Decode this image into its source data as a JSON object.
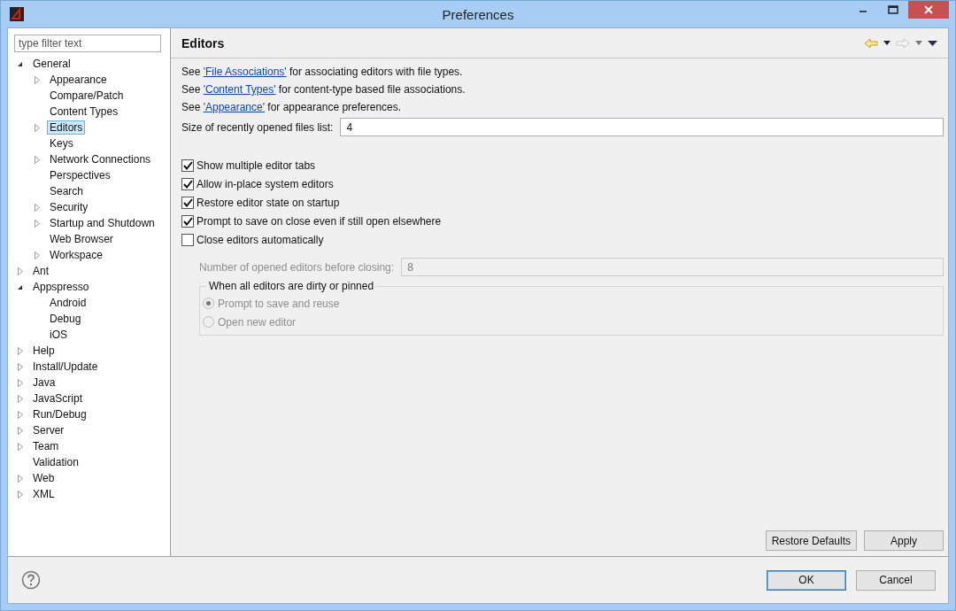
{
  "window": {
    "title": "Preferences"
  },
  "filter": {
    "placeholder": "type filter text"
  },
  "tree": [
    {
      "label": "General",
      "kind": "branch",
      "expanded": true,
      "selected": false,
      "children": [
        {
          "label": "Appearance",
          "kind": "branch",
          "expanded": false,
          "selected": false
        },
        {
          "label": "Compare/Patch",
          "kind": "leaf",
          "selected": false
        },
        {
          "label": "Content Types",
          "kind": "leaf",
          "selected": false
        },
        {
          "label": "Editors",
          "kind": "branch",
          "expanded": false,
          "selected": true
        },
        {
          "label": "Keys",
          "kind": "leaf",
          "selected": false
        },
        {
          "label": "Network Connections",
          "kind": "branch",
          "expanded": false,
          "selected": false
        },
        {
          "label": "Perspectives",
          "kind": "leaf",
          "selected": false
        },
        {
          "label": "Search",
          "kind": "leaf",
          "selected": false
        },
        {
          "label": "Security",
          "kind": "branch",
          "expanded": false,
          "selected": false
        },
        {
          "label": "Startup and Shutdown",
          "kind": "branch",
          "expanded": false,
          "selected": false
        },
        {
          "label": "Web Browser",
          "kind": "leaf",
          "selected": false
        },
        {
          "label": "Workspace",
          "kind": "branch",
          "expanded": false,
          "selected": false
        }
      ]
    },
    {
      "label": "Ant",
      "kind": "branch",
      "expanded": false,
      "selected": false
    },
    {
      "label": "Appspresso",
      "kind": "branch",
      "expanded": true,
      "selected": false,
      "children": [
        {
          "label": "Android",
          "kind": "leaf",
          "selected": false
        },
        {
          "label": "Debug",
          "kind": "leaf",
          "selected": false
        },
        {
          "label": "iOS",
          "kind": "leaf",
          "selected": false
        }
      ]
    },
    {
      "label": "Help",
      "kind": "branch",
      "expanded": false,
      "selected": false
    },
    {
      "label": "Install/Update",
      "kind": "branch",
      "expanded": false,
      "selected": false
    },
    {
      "label": "Java",
      "kind": "branch",
      "expanded": false,
      "selected": false
    },
    {
      "label": "JavaScript",
      "kind": "branch",
      "expanded": false,
      "selected": false
    },
    {
      "label": "Run/Debug",
      "kind": "branch",
      "expanded": false,
      "selected": false
    },
    {
      "label": "Server",
      "kind": "branch",
      "expanded": false,
      "selected": false
    },
    {
      "label": "Team",
      "kind": "branch",
      "expanded": false,
      "selected": false
    },
    {
      "label": "Validation",
      "kind": "leaf",
      "selected": false
    },
    {
      "label": "Web",
      "kind": "branch",
      "expanded": false,
      "selected": false
    },
    {
      "label": "XML",
      "kind": "branch",
      "expanded": false,
      "selected": false
    }
  ],
  "page": {
    "title": "Editors",
    "nav": {
      "back_disabled": false,
      "forward_disabled": true
    },
    "links": [
      {
        "before": "See ",
        "link": "'File Associations'",
        "after": " for associating editors with file types."
      },
      {
        "before": "See ",
        "link": "'Content Types'",
        "after": " for content-type based file associations."
      },
      {
        "before": "See ",
        "link": "'Appearance'",
        "after": " for appearance preferences."
      }
    ],
    "recent_files": {
      "label": "Size of recently opened files list:",
      "value": "4"
    },
    "options": [
      {
        "label": "Show multiple editor tabs",
        "checked": true
      },
      {
        "label": "Allow in-place system editors",
        "checked": true
      },
      {
        "label": "Restore editor state on startup",
        "checked": true
      },
      {
        "label": "Prompt to save on close even if still open elsewhere",
        "checked": true
      },
      {
        "label": "Close editors automatically",
        "checked": false
      }
    ],
    "close_settings": {
      "disabled": true,
      "label": "Number of opened editors before closing:",
      "value": "8",
      "group_title": "When all editors are dirty or pinned",
      "radios": [
        {
          "label": "Prompt to save and reuse",
          "selected": true
        },
        {
          "label": "Open new editor",
          "selected": false
        }
      ]
    },
    "buttons": [
      "Restore Defaults",
      "Apply"
    ]
  },
  "footer": {
    "buttons": [
      {
        "label": "OK",
        "default": true
      },
      {
        "label": "Cancel",
        "default": false
      }
    ]
  }
}
